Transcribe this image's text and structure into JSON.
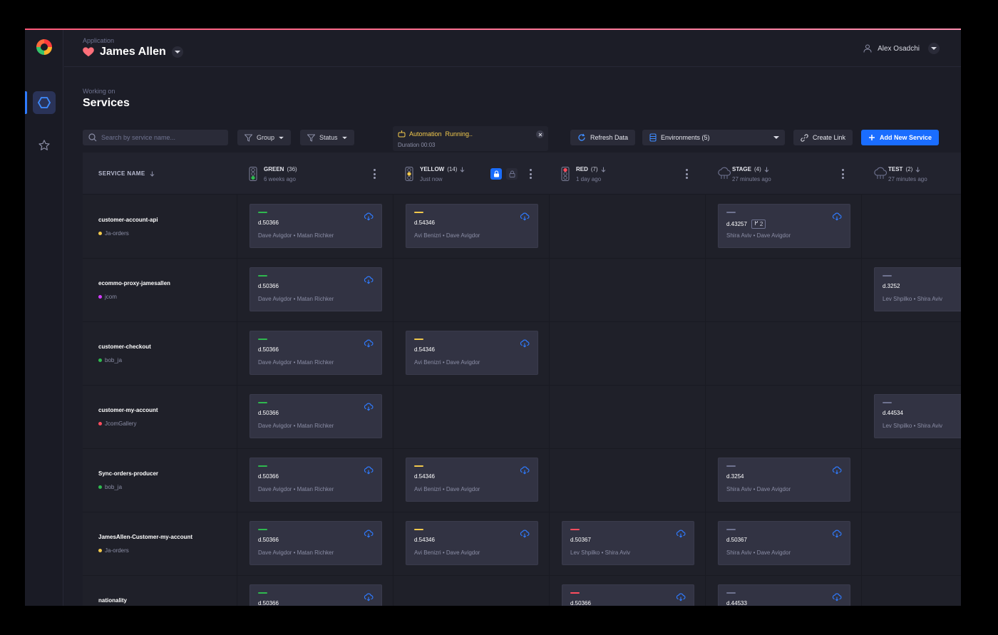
{
  "header": {
    "app_caption": "Application",
    "app_name": "James Allen",
    "user_name": "Alex Osadchi"
  },
  "page": {
    "caption": "Working on",
    "title": "Services"
  },
  "toolbar": {
    "search_placeholder": "Search by service name...",
    "group_label": "Group",
    "status_label": "Status",
    "refresh_label": "Refresh Data",
    "environments_label": "Environments (5)",
    "create_link_label": "Create Link",
    "add_service_label": "Add New Service"
  },
  "automation": {
    "label": "Automation",
    "state": "Running..",
    "duration": "Duration 00:03"
  },
  "columns": {
    "service_header": "SERVICE NAME",
    "envs": [
      {
        "name": "GREEN",
        "count": "(36)",
        "updated": "6 weeks ago"
      },
      {
        "name": "YELLOW",
        "count": "(14)",
        "updated": "Just now"
      },
      {
        "name": "RED",
        "count": "(7)",
        "updated": "1 day ago"
      },
      {
        "name": "STAGE",
        "count": "(4)",
        "updated": "27 minutes ago"
      },
      {
        "name": "TEST",
        "count": "(2)",
        "updated": "27 minutes ago"
      }
    ]
  },
  "colors": {
    "green": "#2fb94f",
    "yellow": "#f2c94c",
    "red": "#ff4d5e",
    "gray": "#6f7390",
    "accent": "#1a6dff",
    "tag_yellow": "#f2c94c",
    "tag_magenta": "#d33cff",
    "tag_green": "#2fb94f",
    "tag_red": "#ff4d5e"
  },
  "rows": [
    {
      "service": "customer-account-api",
      "tag": "Ja-orders",
      "tag_color": "yellow",
      "cells": [
        {
          "env": 0,
          "version": "d.50366",
          "people": "Dave Avigdor • Matan Richker"
        },
        {
          "env": 1,
          "version": "d.54346",
          "people": "Avi Benizri • Dave Avigdor"
        },
        {
          "env": 3,
          "version": "d.43257",
          "badge": "2",
          "people": "Shira Aviv • Dave Avigdor"
        }
      ]
    },
    {
      "service": "ecommo-proxy-jamesallen",
      "tag": "jcom",
      "tag_color": "magenta",
      "cells": [
        {
          "env": 0,
          "version": "d.50366",
          "people": "Dave Avigdor • Matan Richker"
        },
        {
          "env": 4,
          "version": "d.3252",
          "people": "Lev Shpilko • Shira Aviv"
        }
      ]
    },
    {
      "service": "customer-checkout",
      "tag": "bob_ja",
      "tag_color": "green",
      "cells": [
        {
          "env": 0,
          "version": "d.50366",
          "people": "Dave Avigdor • Matan Richker"
        },
        {
          "env": 1,
          "version": "d.54346",
          "people": "Avi Benizri • Dave Avigdor"
        }
      ]
    },
    {
      "service": "customer-my-account",
      "tag": "JcomGallery",
      "tag_color": "red",
      "cells": [
        {
          "env": 0,
          "version": "d.50366",
          "people": "Dave Avigdor • Matan Richker"
        },
        {
          "env": 4,
          "version": "d.44534",
          "people": "Lev Shpilko • Shira Aviv"
        }
      ]
    },
    {
      "service": "Sync-orders-producer",
      "tag": "bob_ja",
      "tag_color": "green",
      "cells": [
        {
          "env": 0,
          "version": "d.50366",
          "people": "Dave Avigdor • Matan Richker"
        },
        {
          "env": 1,
          "version": "d.54346",
          "people": "Avi Benizri • Dave Avigdor"
        },
        {
          "env": 3,
          "version": "d.3254",
          "people": "Shira Aviv • Dave Avigdor"
        }
      ]
    },
    {
      "service": "JamesAllen-Customer-my-account",
      "tag": "Ja-orders",
      "tag_color": "yellow",
      "cells": [
        {
          "env": 0,
          "version": "d.50366",
          "people": "Dave Avigdor • Matan Richker"
        },
        {
          "env": 1,
          "version": "d.54346",
          "people": "Avi Benizri • Dave Avigdor"
        },
        {
          "env": 2,
          "version": "d.50367",
          "people": "Lev Shpilko • Shira Aviv"
        },
        {
          "env": 3,
          "version": "d.50367",
          "people": "Shira Aviv • Dave Avigdor"
        }
      ]
    },
    {
      "service": "nationality",
      "tag": "",
      "tag_color": "",
      "cells": [
        {
          "env": 0,
          "version": "d.50366",
          "people": ""
        },
        {
          "env": 2,
          "version": "d.50366",
          "people": ""
        },
        {
          "env": 3,
          "version": "d.44533",
          "people": ""
        }
      ]
    }
  ]
}
